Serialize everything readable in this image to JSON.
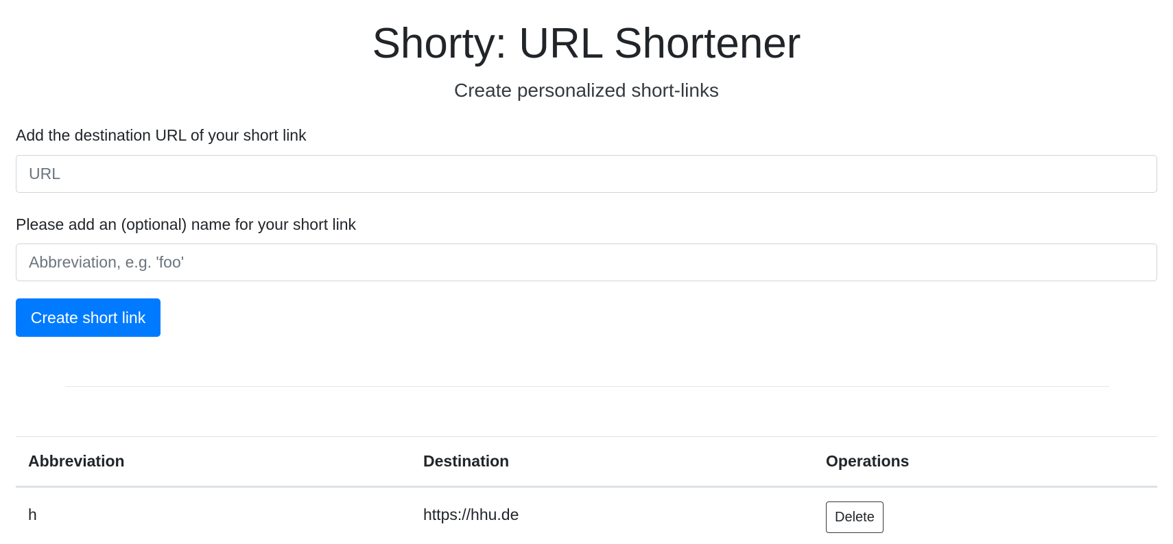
{
  "header": {
    "title": "Shorty: URL Shortener",
    "subtitle": "Create personalized short-links"
  },
  "form": {
    "url_label": "Add the destination URL of your short link",
    "url_value": "",
    "url_placeholder": "URL",
    "name_label": "Please add an (optional) name for your short link",
    "name_value": "",
    "name_placeholder": "Abbreviation, e.g. 'foo'",
    "submit_label": "Create short link"
  },
  "table": {
    "headers": [
      "Abbreviation",
      "Destination",
      "Operations"
    ],
    "rows": [
      {
        "abbreviation": "h",
        "destination": "https://hhu.de",
        "delete_label": "Delete"
      }
    ]
  },
  "colors": {
    "primary": "#007bff",
    "text": "#212529",
    "border": "#ced4da"
  }
}
